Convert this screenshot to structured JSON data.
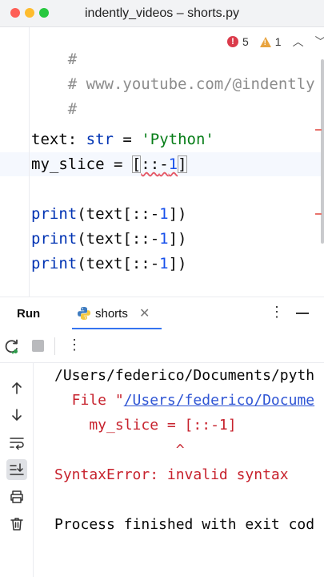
{
  "window": {
    "title": "indently_videos – shorts.py"
  },
  "editor": {
    "inspections": {
      "errors": "5",
      "warnings": "1"
    },
    "lines": {
      "l1": "#",
      "l2": "# www.youtube.com/@indently",
      "l3": "#",
      "l4_var": "text",
      "l4_colon": ": ",
      "l4_type": "str",
      "l4_eq": " = ",
      "l4_str": "'Python'",
      "l5_var": "my_slice = ",
      "l5_open": "[",
      "l5_colons": "::",
      "l5_minus": "-",
      "l5_num": "1",
      "l5_close": "]",
      "print_fn": "print",
      "print_open": "(text[::-",
      "print_num": "1",
      "print_close": "])"
    }
  },
  "run_panel": {
    "title": "Run",
    "tab_label": "shorts",
    "close_glyph": "✕",
    "kebab_glyph": "⋮"
  },
  "console": {
    "line1": "/Users/federico/Documents/pyth",
    "line2_prefix": "  File \"",
    "line2_link": "/Users/federico/Docume",
    "line3": "    my_slice = [::-1]",
    "line4": "              ^",
    "line5": "SyntaxError: invalid syntax",
    "line6": "Process finished with exit cod"
  },
  "icons": {
    "rerun": "rerun-icon",
    "stop": "stop-icon",
    "up": "arrow-up-icon",
    "down": "arrow-down-icon",
    "wrap": "soft-wrap-icon",
    "scroll_end": "scroll-to-end-icon",
    "print": "print-icon",
    "trash": "trash-icon"
  },
  "colors": {
    "error_red": "#c7222d",
    "link_blue": "#2f55d4",
    "accent_blue": "#3574f0"
  }
}
